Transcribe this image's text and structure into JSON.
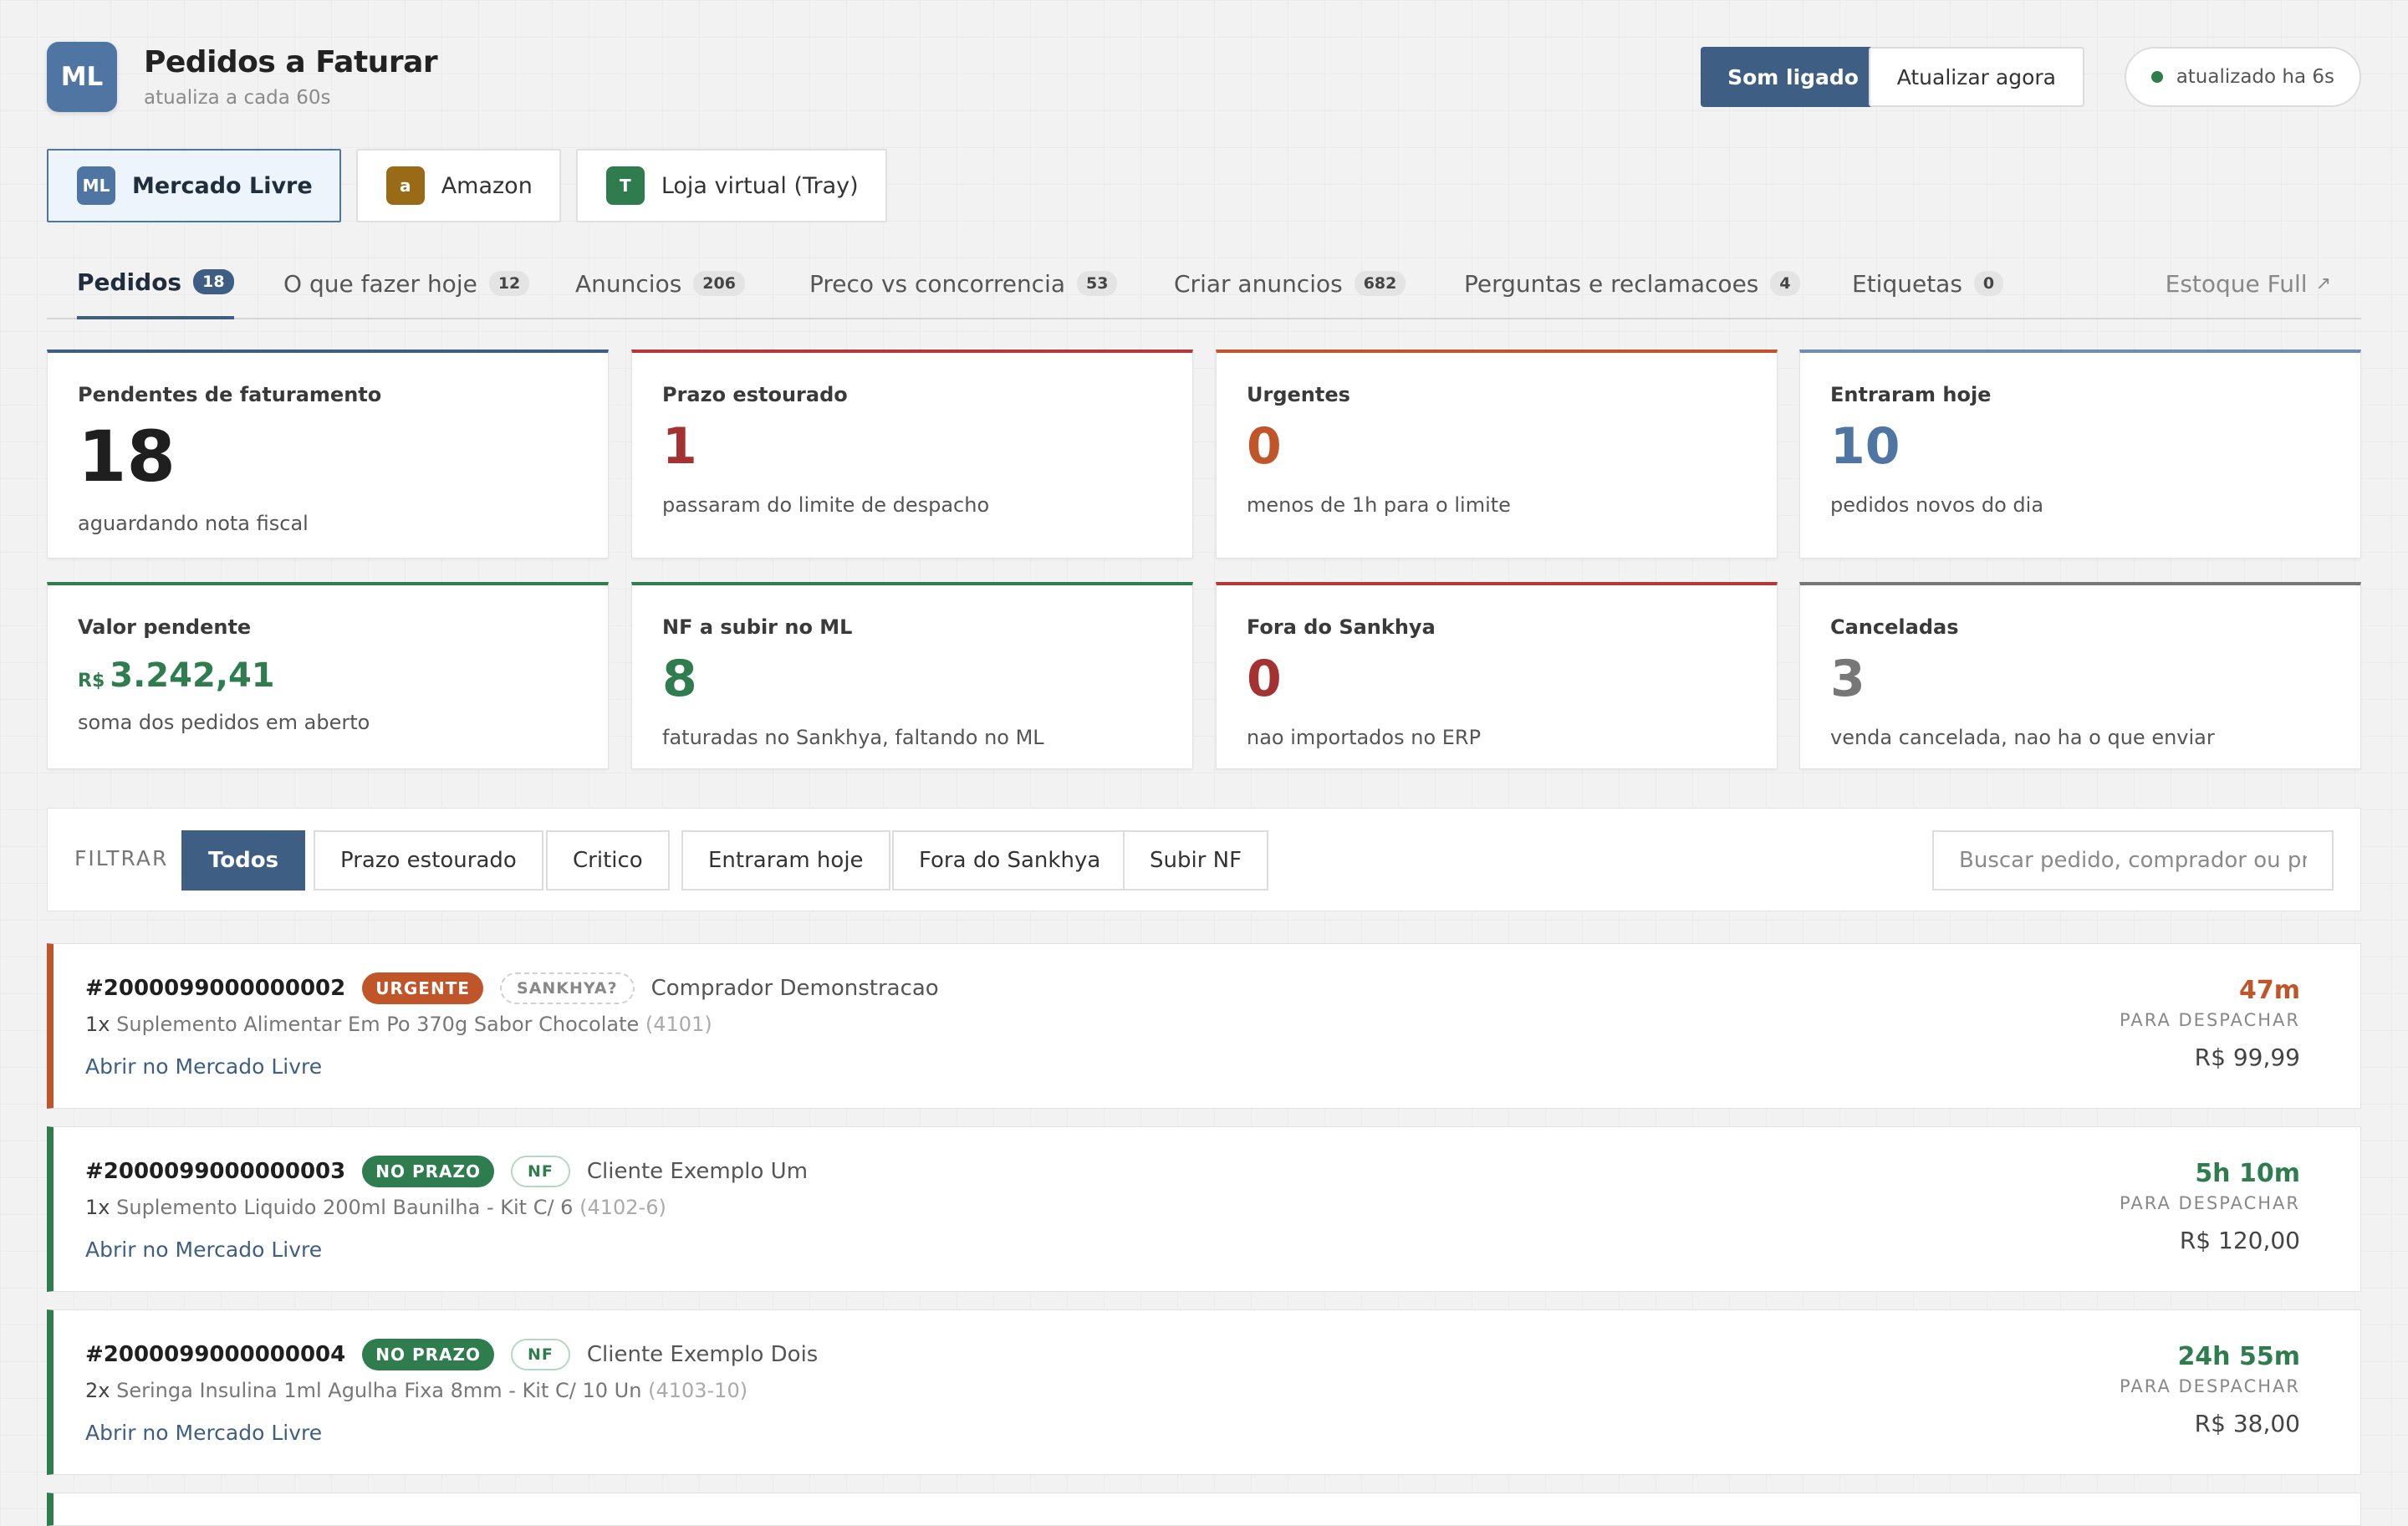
{
  "header": {
    "logo_text": "ML",
    "title": "Pedidos a Faturar",
    "subtitle": "atualiza a cada 60s",
    "sound_button": "Som ligado",
    "refresh_button": "Atualizar agora",
    "status_text": "atualizado ha 6s"
  },
  "markets": [
    {
      "badge": "ML",
      "label": "Mercado Livre",
      "color": "#4f75a3",
      "active": true
    },
    {
      "badge": "a",
      "label": "Amazon",
      "color": "#9a6b17",
      "active": false
    },
    {
      "badge": "T",
      "label": "Loja virtual (Tray)",
      "color": "#2f7d4f",
      "active": false
    }
  ],
  "tabs": [
    {
      "label": "Pedidos",
      "count": "18",
      "active": true
    },
    {
      "label": "O que fazer hoje",
      "count": "12"
    },
    {
      "label": "Anuncios",
      "count": "206"
    },
    {
      "label": "Preco vs concorrencia",
      "count": "53"
    },
    {
      "label": "Criar anuncios",
      "count": "682"
    },
    {
      "label": "Perguntas e reclamacoes",
      "count": "4"
    },
    {
      "label": "Etiquetas",
      "count": "0"
    }
  ],
  "external_tab": {
    "label": "Estoque Full",
    "icon": "external-link-icon"
  },
  "cards": [
    {
      "label": "Pendentes de faturamento",
      "value": "18",
      "desc": "aguardando nota fiscal",
      "accent": "#3e5f83",
      "value_color": "#1f1f1f"
    },
    {
      "label": "Prazo estourado",
      "value": "1",
      "desc": "passaram do limite de despacho",
      "accent": "#b23a3a",
      "value_color": "#a33232"
    },
    {
      "label": "Urgentes",
      "value": "0",
      "desc": "menos de 1h para o limite",
      "accent": "#c0552a",
      "value_color": "#c0552a"
    },
    {
      "label": "Entraram hoje",
      "value": "10",
      "desc": "pedidos novos do dia",
      "accent": "#6f8db2",
      "value_color": "#4f75a3"
    },
    {
      "label": "Valor pendente",
      "currency": "R$",
      "value": "3.242,41",
      "desc": "soma dos pedidos em aberto",
      "accent": "#2f7d4f",
      "value_color": "#2f7d4f"
    },
    {
      "label": "NF a subir no ML",
      "value": "8",
      "desc": "faturadas no Sankhya, faltando no ML",
      "accent": "#2f7d4f",
      "value_color": "#2f7d4f"
    },
    {
      "label": "Fora do Sankhya",
      "value": "0",
      "desc": "nao importados no ERP",
      "accent": "#b23a3a",
      "value_color": "#a33232"
    },
    {
      "label": "Canceladas",
      "value": "3",
      "desc": "venda cancelada, nao ha o que enviar",
      "accent": "#777777",
      "value_color": "#777777"
    }
  ],
  "filter": {
    "label": "FILTRAR",
    "chips": [
      {
        "label": "Todos",
        "active": true
      },
      {
        "label": "Prazo estourado"
      },
      {
        "label": "Critico"
      },
      {
        "label": "Entraram hoje"
      },
      {
        "label": "Fora do Sankhya"
      },
      {
        "label": "Subir NF"
      }
    ],
    "search_placeholder": "Buscar pedido, comprador ou produto"
  },
  "orders": [
    {
      "id": "#2000099000000002",
      "status": "URGENTE",
      "status_color": "#c0552a",
      "tag": "SANKHYA?",
      "tag_type": "sk",
      "buyer": "Comprador Demonstracao",
      "qty": "1x",
      "product": "Suplemento Alimentar Em Po 370g Sabor Chocolate",
      "sku": "(4101)",
      "link": "Abrir no Mercado Livre",
      "time": "47m",
      "time_label": "PARA DESPACHAR",
      "value": "R$ 99,99",
      "urgent": true
    },
    {
      "id": "#2000099000000003",
      "status": "NO PRAZO",
      "status_color": "#2f7d4f",
      "tag": "NF",
      "tag_type": "nf",
      "buyer": "Cliente Exemplo Um",
      "qty": "1x",
      "product": "Suplemento Liquido 200ml Baunilha - Kit C/ 6",
      "sku": "(4102-6)",
      "link": "Abrir no Mercado Livre",
      "time": "5h 10m",
      "time_label": "PARA DESPACHAR",
      "value": "R$ 120,00"
    },
    {
      "id": "#2000099000000004",
      "status": "NO PRAZO",
      "status_color": "#2f7d4f",
      "tag": "NF",
      "tag_type": "nf",
      "buyer": "Cliente Exemplo Dois",
      "qty": "2x",
      "product": "Seringa Insulina 1ml Agulha Fixa 8mm - Kit C/ 10 Un",
      "sku": "(4103-10)",
      "link": "Abrir no Mercado Livre",
      "time": "24h 55m",
      "time_label": "PARA DESPACHAR",
      "value": "R$ 38,00"
    }
  ]
}
